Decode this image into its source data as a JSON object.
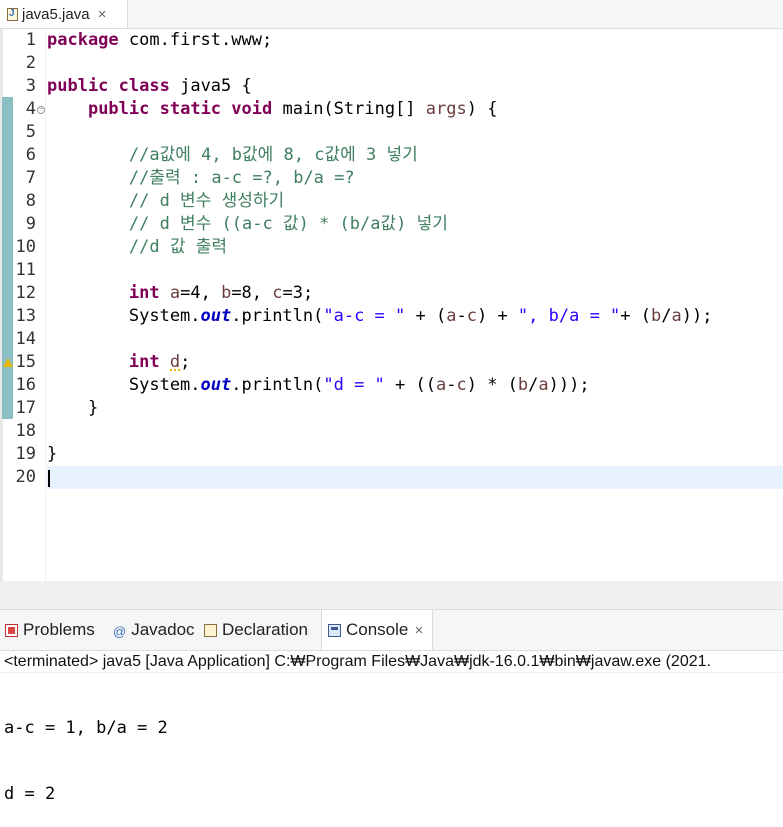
{
  "editor_tab": {
    "label": "java5.java",
    "close": "✕"
  },
  "lines": [
    {
      "n": "1",
      "parts": [
        {
          "t": "package",
          "c": "kw"
        },
        {
          "t": " com.first.www;",
          "c": ""
        }
      ]
    },
    {
      "n": "2",
      "parts": []
    },
    {
      "n": "3",
      "parts": [
        {
          "t": "public",
          "c": "kw"
        },
        {
          "t": " ",
          "c": ""
        },
        {
          "t": "class",
          "c": "kw"
        },
        {
          "t": " java5 {",
          "c": ""
        }
      ]
    },
    {
      "n": "4",
      "parts": [
        {
          "t": "    ",
          "c": ""
        },
        {
          "t": "public",
          "c": "kw"
        },
        {
          "t": " ",
          "c": ""
        },
        {
          "t": "static",
          "c": "kw"
        },
        {
          "t": " ",
          "c": ""
        },
        {
          "t": "void",
          "c": "kw"
        },
        {
          "t": " main(String[] ",
          "c": ""
        },
        {
          "t": "args",
          "c": "var"
        },
        {
          "t": ") {",
          "c": ""
        }
      ]
    },
    {
      "n": "5",
      "parts": []
    },
    {
      "n": "6",
      "parts": [
        {
          "t": "        //a값에 4, b값에 8, c값에 3 넣기",
          "c": "cm"
        }
      ]
    },
    {
      "n": "7",
      "parts": [
        {
          "t": "        //출력 : a-c =?, b/a =?",
          "c": "cm"
        }
      ]
    },
    {
      "n": "8",
      "parts": [
        {
          "t": "        // d 변수 생성하기",
          "c": "cm"
        }
      ]
    },
    {
      "n": "9",
      "parts": [
        {
          "t": "        // d 변수 ((a-c 값) * (b/a값) 넣기",
          "c": "cm"
        }
      ]
    },
    {
      "n": "10",
      "parts": [
        {
          "t": "        //d 값 출력",
          "c": "cm"
        }
      ]
    },
    {
      "n": "11",
      "parts": []
    },
    {
      "n": "12",
      "parts": [
        {
          "t": "        ",
          "c": ""
        },
        {
          "t": "int",
          "c": "kw"
        },
        {
          "t": " ",
          "c": ""
        },
        {
          "t": "a",
          "c": "var"
        },
        {
          "t": "=4, ",
          "c": ""
        },
        {
          "t": "b",
          "c": "var"
        },
        {
          "t": "=8, ",
          "c": ""
        },
        {
          "t": "c",
          "c": "var"
        },
        {
          "t": "=3;",
          "c": ""
        }
      ]
    },
    {
      "n": "13",
      "parts": [
        {
          "t": "        System.",
          "c": ""
        },
        {
          "t": "out",
          "c": "fld"
        },
        {
          "t": ".println(",
          "c": ""
        },
        {
          "t": "\"a-c = \"",
          "c": "st"
        },
        {
          "t": " + (",
          "c": ""
        },
        {
          "t": "a",
          "c": "var"
        },
        {
          "t": "-",
          "c": ""
        },
        {
          "t": "c",
          "c": "var"
        },
        {
          "t": ") + ",
          "c": ""
        },
        {
          "t": "\", b/a = \"",
          "c": "st"
        },
        {
          "t": "+ (",
          "c": ""
        },
        {
          "t": "b",
          "c": "var"
        },
        {
          "t": "/",
          "c": ""
        },
        {
          "t": "a",
          "c": "var"
        },
        {
          "t": "));",
          "c": ""
        }
      ]
    },
    {
      "n": "14",
      "parts": []
    },
    {
      "n": "15",
      "parts": [
        {
          "t": "        ",
          "c": ""
        },
        {
          "t": "int",
          "c": "kw"
        },
        {
          "t": " ",
          "c": ""
        },
        {
          "t": "d",
          "c": "var warn"
        },
        {
          "t": ";",
          "c": ""
        }
      ]
    },
    {
      "n": "16",
      "parts": [
        {
          "t": "        System.",
          "c": ""
        },
        {
          "t": "out",
          "c": "fld"
        },
        {
          "t": ".println(",
          "c": ""
        },
        {
          "t": "\"d = \"",
          "c": "st"
        },
        {
          "t": " + ((",
          "c": ""
        },
        {
          "t": "a",
          "c": "var"
        },
        {
          "t": "-",
          "c": ""
        },
        {
          "t": "c",
          "c": "var"
        },
        {
          "t": ") * (",
          "c": ""
        },
        {
          "t": "b",
          "c": "var"
        },
        {
          "t": "/",
          "c": ""
        },
        {
          "t": "a",
          "c": "var"
        },
        {
          "t": ")));",
          "c": ""
        }
      ]
    },
    {
      "n": "17",
      "parts": [
        {
          "t": "    }",
          "c": ""
        }
      ]
    },
    {
      "n": "18",
      "parts": []
    },
    {
      "n": "19",
      "parts": [
        {
          "t": "}",
          "c": ""
        }
      ]
    },
    {
      "n": "20",
      "parts": []
    }
  ],
  "views_tabs": {
    "problems": "Problems",
    "javadoc": "Javadoc",
    "declaration": "Declaration",
    "console": "Console",
    "close": "✕"
  },
  "console": {
    "status": "<terminated> java5 [Java Application] C:₩Program Files₩Java₩jdk-16.0.1₩bin₩javaw.exe  (2021.",
    "output": [
      "a-c = 1, b/a = 2",
      "d = 2"
    ]
  }
}
